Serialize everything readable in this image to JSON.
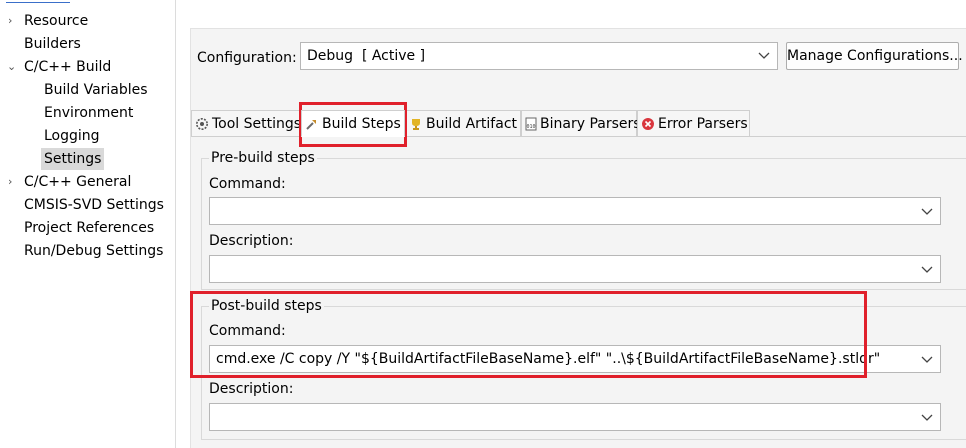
{
  "tree": {
    "items": [
      {
        "label": "Resource",
        "expandable": true
      },
      {
        "label": "Builders",
        "expandable": false
      },
      {
        "label": "C/C++ Build",
        "expandable": true,
        "expanded": true
      },
      {
        "label": "Build Variables",
        "expandable": false
      },
      {
        "label": "Environment",
        "expandable": false
      },
      {
        "label": "Logging",
        "expandable": false
      },
      {
        "label": "Settings",
        "expandable": false,
        "selected": true
      },
      {
        "label": "C/C++ General",
        "expandable": true
      },
      {
        "label": "CMSIS-SVD Settings",
        "expandable": false
      },
      {
        "label": "Project References",
        "expandable": false
      },
      {
        "label": "Run/Debug Settings",
        "expandable": false
      }
    ]
  },
  "config": {
    "label": "Configuration:",
    "value": "Debug  [ Active ]",
    "manage_button": "Manage Configurations..."
  },
  "tabs": [
    {
      "label": "Tool Settings",
      "icon": "gear-icon"
    },
    {
      "label": "Build Steps",
      "icon": "build-steps-icon",
      "active": true
    },
    {
      "label": "Build Artifact",
      "icon": "trophy-icon"
    },
    {
      "label": "Binary Parsers",
      "icon": "binary-icon"
    },
    {
      "label": "Error Parsers",
      "icon": "error-icon"
    }
  ],
  "pre_build": {
    "title": "Pre-build steps",
    "command_label": "Command:",
    "command_value": "",
    "description_label": "Description:",
    "description_value": ""
  },
  "post_build": {
    "title": "Post-build steps",
    "command_label": "Command:",
    "command_value": "cmd.exe /C copy /Y \"${BuildArtifactFileBaseName}.elf\" \"..\\${BuildArtifactFileBaseName}.stldr\"",
    "description_label": "Description:",
    "description_value": ""
  },
  "colors": {
    "highlight": "#e0202b",
    "selection": "#d9d9d9",
    "panel": "#f4f4f4"
  }
}
